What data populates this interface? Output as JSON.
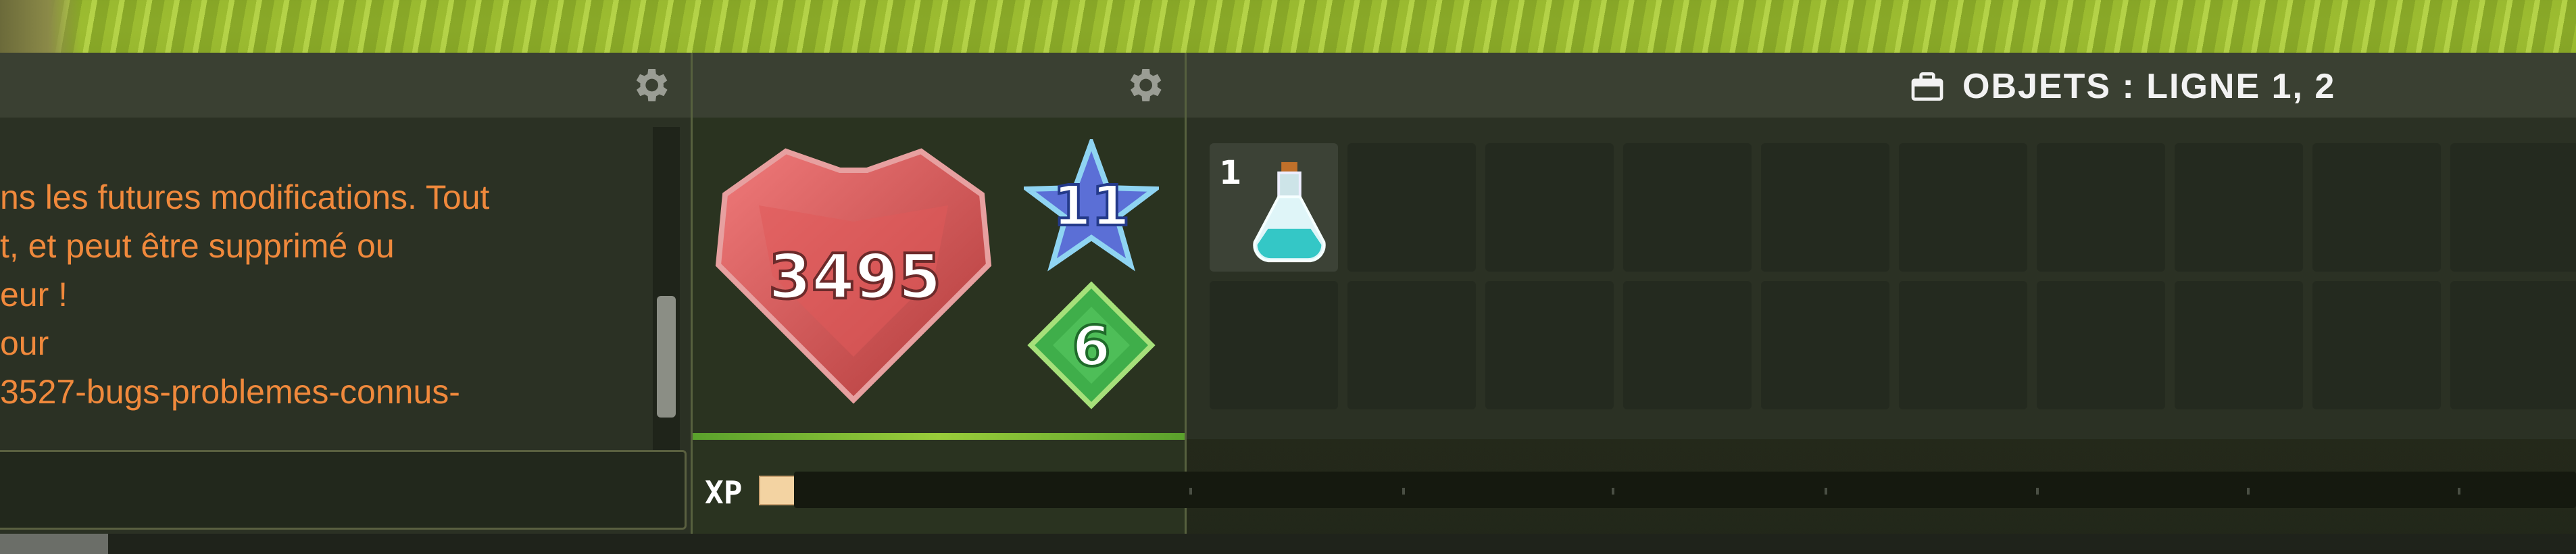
{
  "chat": {
    "lines": [
      "ns les futures modifications. Tout",
      "t, et peut être supprimé ou",
      "eur !",
      "our",
      "3527-bugs-problemes-connus-"
    ],
    "settings_icon": "gear-icon",
    "input_value": ""
  },
  "stats": {
    "health": "3495",
    "level": "11",
    "gems": "6",
    "settings_icon": "gear-icon"
  },
  "items": {
    "title": "OBJETS : LIGNE 1, 2",
    "title_icon": "briefcase-icon",
    "slots": [
      {
        "count": "1",
        "item": "potion-icon"
      }
    ]
  },
  "xp": {
    "label": "XP",
    "progress_fraction": 0.0
  },
  "colors": {
    "chat_text": "#f0893c",
    "panel_bg": "#2b3124",
    "header_bg": "#3a4032"
  }
}
